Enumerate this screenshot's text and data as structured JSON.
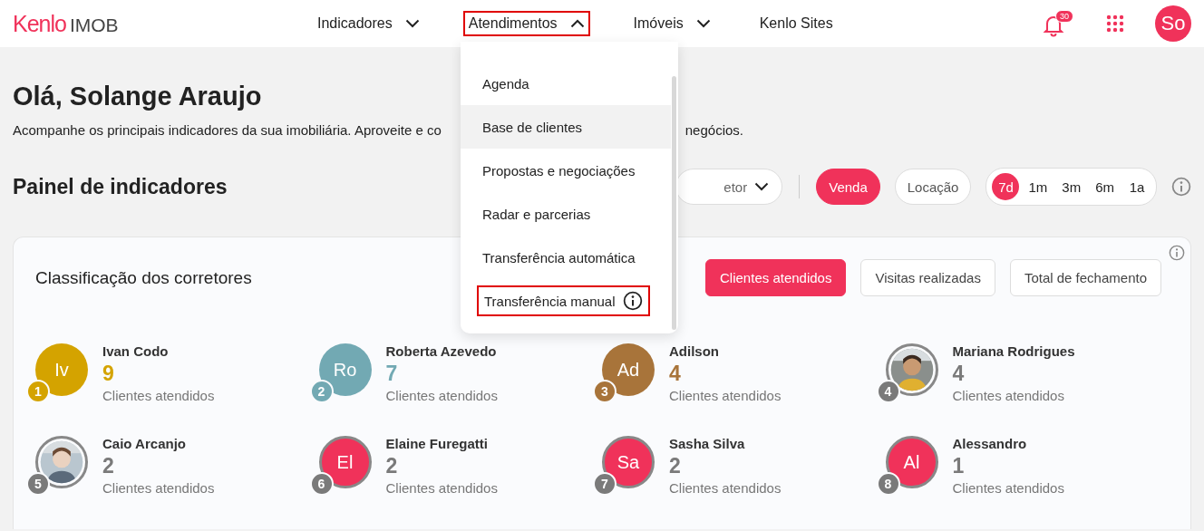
{
  "header": {
    "logo": "Kenlo",
    "product": "IMOB",
    "nav": [
      {
        "label": "Indicadores",
        "dropdown": true,
        "expanded": false,
        "highlighted": false
      },
      {
        "label": "Atendimentos",
        "dropdown": true,
        "expanded": true,
        "highlighted": true
      },
      {
        "label": "Imóveis",
        "dropdown": true,
        "expanded": false,
        "highlighted": false
      },
      {
        "label": "Kenlo Sites",
        "dropdown": false,
        "highlighted": false
      }
    ],
    "notifications": "30",
    "user_initials": "So"
  },
  "menu": {
    "items": [
      {
        "label": "Agenda",
        "selected": false,
        "highlighted": false,
        "info": false
      },
      {
        "label": "Base de clientes",
        "selected": true,
        "highlighted": false,
        "info": false
      },
      {
        "label": "Propostas e negociações",
        "selected": false,
        "highlighted": false,
        "info": false
      },
      {
        "label": "Radar e parcerias",
        "selected": false,
        "highlighted": false,
        "info": false
      },
      {
        "label": "Transferência automática",
        "selected": false,
        "highlighted": false,
        "info": false
      },
      {
        "label": "Transferência manual",
        "selected": false,
        "highlighted": true,
        "info": true
      }
    ]
  },
  "greeting": "Olá, Solange Araujo",
  "subtitle_start": "Acompanhe os principais indicadores da sua imobiliária. Aproveite e co",
  "subtitle_end": "negócios.",
  "panel": {
    "title": "Painel de indicadores",
    "filter": "etor",
    "deal_types": [
      {
        "label": "Venda",
        "selected": true
      },
      {
        "label": "Locação",
        "selected": false
      }
    ],
    "periods": [
      {
        "label": "7d",
        "selected": true
      },
      {
        "label": "1m",
        "selected": false
      },
      {
        "label": "3m",
        "selected": false
      },
      {
        "label": "6m",
        "selected": false
      },
      {
        "label": "1a",
        "selected": false
      }
    ]
  },
  "ranking": {
    "title": "Classificação dos corretores",
    "metrics": [
      {
        "label": "Clientes atendidos",
        "selected": true
      },
      {
        "label": "Visitas realizadas",
        "selected": false
      },
      {
        "label": "Total de fechamento",
        "selected": false
      }
    ],
    "brokers": [
      {
        "rank": "1",
        "name": "Ivan Codo",
        "count": "9",
        "caption": "Clientes atendidos",
        "kind": "initials",
        "initials": "Iv",
        "color": "#d4a300"
      },
      {
        "rank": "2",
        "name": "Roberta Azevedo",
        "count": "7",
        "caption": "Clientes atendidos",
        "kind": "initials",
        "initials": "Ro",
        "color": "#72a9b3"
      },
      {
        "rank": "3",
        "name": "Adilson",
        "count": "4",
        "caption": "Clientes atendidos",
        "kind": "initials",
        "initials": "Ad",
        "color": "#a8743a"
      },
      {
        "rank": "4",
        "name": "Mariana Rodrigues",
        "count": "4",
        "caption": "Clientes atendidos",
        "kind": "picture",
        "color": "#7a7a7a"
      },
      {
        "rank": "5",
        "name": "Caio Arcanjo",
        "count": "2",
        "caption": "Clientes atendidos",
        "kind": "picture",
        "color": "#7a7a7a"
      },
      {
        "rank": "6",
        "name": "Elaine Furegatti",
        "count": "2",
        "caption": "Clientes atendidos",
        "kind": "initials",
        "initials": "El",
        "color": "#7a7a7a"
      },
      {
        "rank": "7",
        "name": "Sasha Silva",
        "count": "2",
        "caption": "Clientes atendidos",
        "kind": "initials",
        "initials": "Sa",
        "color": "#7a7a7a"
      },
      {
        "rank": "8",
        "name": "Alessandro",
        "count": "1",
        "caption": "Clientes atendidos",
        "kind": "initials",
        "initials": "Al",
        "color": "#7a7a7a"
      }
    ]
  }
}
